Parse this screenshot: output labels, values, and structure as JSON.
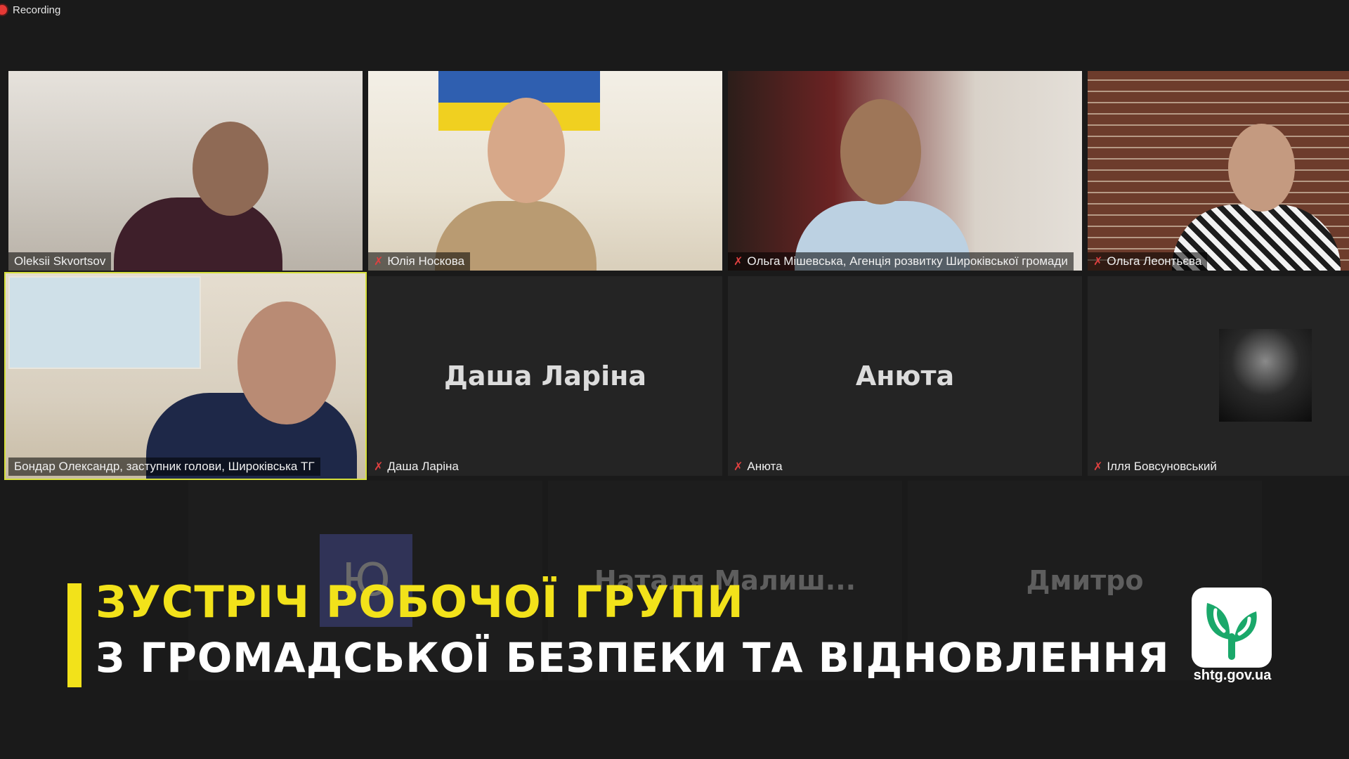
{
  "recording": {
    "label": "Recording"
  },
  "tiles": [
    {
      "name": "Oleksii Skvortsov",
      "muted": false
    },
    {
      "name": "Юлія Носкова",
      "muted": true
    },
    {
      "name": "Ольга Мішевська, Агенція розвитку Широківської громади",
      "muted": true
    },
    {
      "name": "Ольга Леонтьєва",
      "muted": true
    },
    {
      "name": "Бондар Олександр, заступник голови, Широківська ТГ",
      "muted": false,
      "active": true
    },
    {
      "name": "Даша Ларіна",
      "center": "Даша Ларіна",
      "muted": true
    },
    {
      "name": "Анюта",
      "center": "Анюта",
      "muted": true
    },
    {
      "name": "Ілля Бовсуновський",
      "muted": true
    }
  ],
  "faded_tiles": [
    {
      "avatar_letter": "Ю"
    },
    {
      "center": "Наталя Малиш..."
    },
    {
      "center": "Дмитро"
    }
  ],
  "overlay": {
    "line1": "ЗУСТРІЧ РОБОЧОЇ ГРУПИ",
    "line2": "З ГРОМАДСЬКОЇ БЕЗПЕКИ ТА ВІДНОВЛЕННЯ",
    "line1_color": "#f2e21a",
    "line2_color": "#ffffff"
  },
  "logo": {
    "text": "shtg.gov.ua",
    "icon": "leaf-sprout-icon",
    "color": "#1aa86a"
  },
  "colors": {
    "active_border": "#d6df3b",
    "muted_icon": "#e04040"
  }
}
